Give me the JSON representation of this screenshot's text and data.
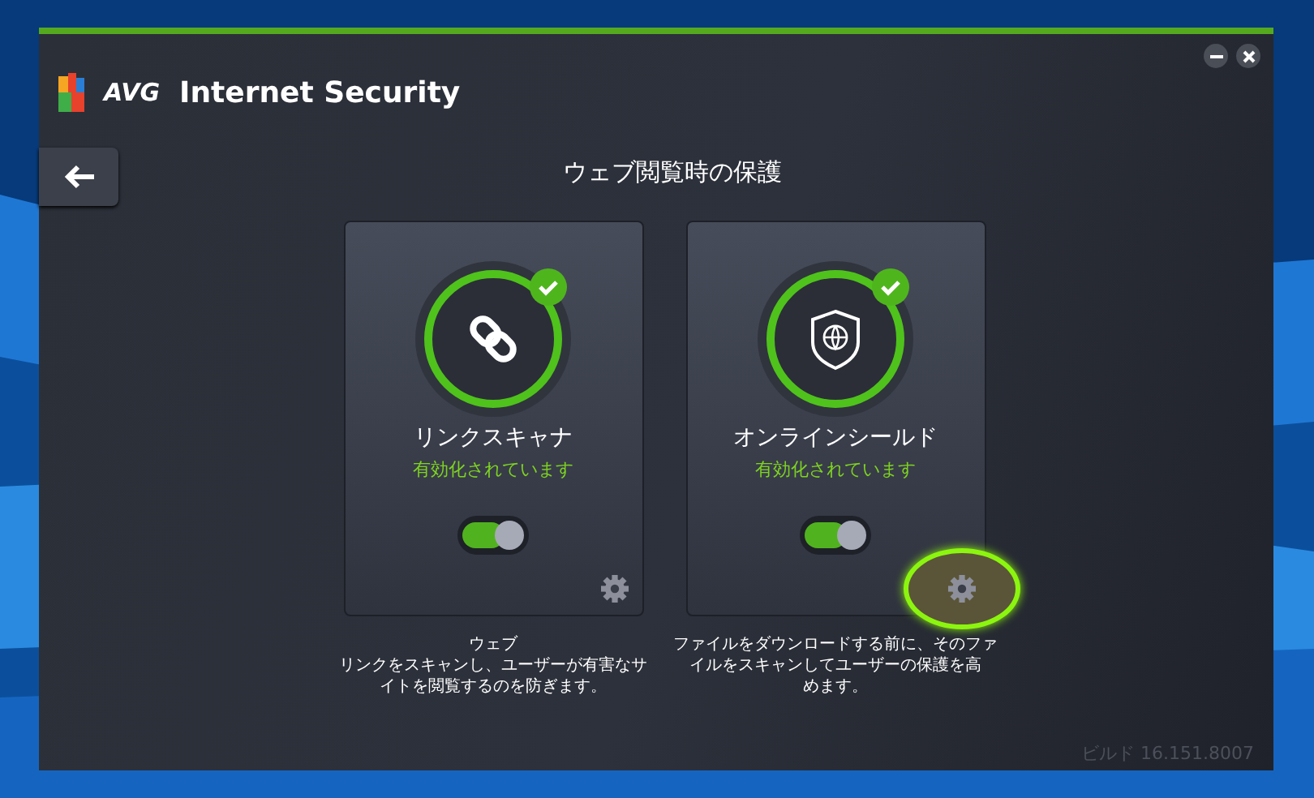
{
  "window": {
    "brand": "AVG",
    "product": "Internet Security"
  },
  "page": {
    "title": "ウェブ閲覧時の保護"
  },
  "cards": [
    {
      "kind": "link",
      "name": "リンクスキャナ",
      "status": "有効化されています",
      "on": true,
      "highlighted": false,
      "description_lines": [
        "ウェブ",
        "リンクをスキャンし、ユーザーが有害なサ",
        "イトを閲覧するのを防ぎます。"
      ]
    },
    {
      "kind": "shield",
      "name": "オンラインシールド",
      "status": "有効化されています",
      "on": true,
      "highlighted": true,
      "description_lines": [
        "ファイルをダウンロードする前に、そのファ",
        "イルをスキャンしてユーザーの保護を高",
        "めます。"
      ]
    }
  ],
  "status_bar": {
    "build": "ビルド 16.151.8007"
  }
}
